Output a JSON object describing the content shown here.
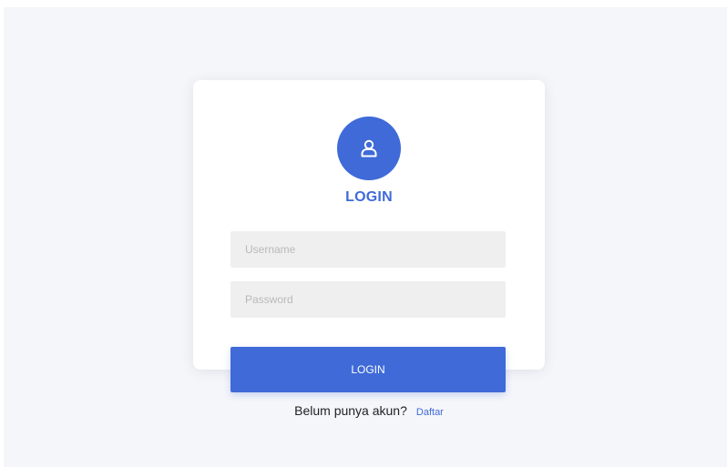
{
  "colors": {
    "accent": "#3f6ad8",
    "page_background": "#f5f6fa",
    "card_background": "#ffffff",
    "input_background": "#efefef"
  },
  "header": {
    "icon": "user-icon",
    "title": "LOGIN"
  },
  "form": {
    "username_placeholder": "Username",
    "password_placeholder": "Password",
    "submit_label": "LOGIN"
  },
  "footer": {
    "prompt": "Belum punya akun?",
    "register_link": "Daftar"
  }
}
